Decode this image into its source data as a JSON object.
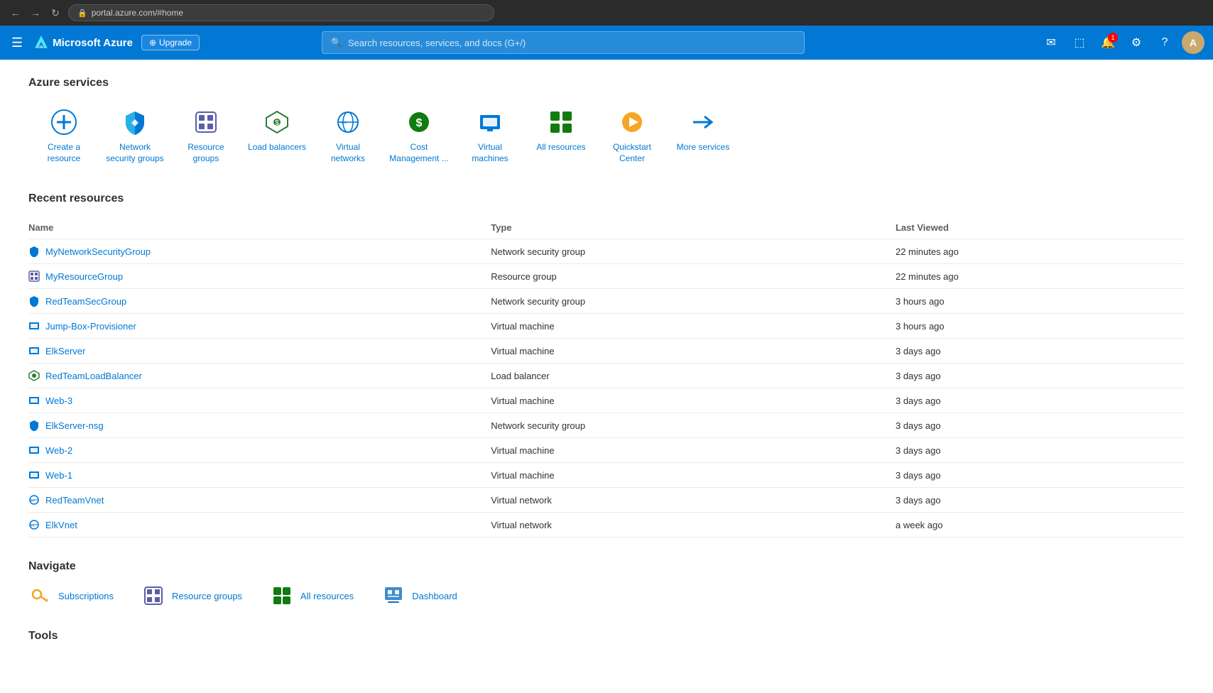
{
  "browser": {
    "url": "portal.azure.com/#home",
    "back_label": "←",
    "forward_label": "→",
    "refresh_label": "↻"
  },
  "nav": {
    "menu_icon": "☰",
    "brand": "Microsoft Azure",
    "upgrade_label": "⊕ Upgrade",
    "search_placeholder": "Search resources, services, and docs (G+/)",
    "icons": {
      "feedback": "✉",
      "cloud_shell": "⬚",
      "notifications_count": "1",
      "settings": "⚙",
      "help": "?",
      "avatar_initials": "A"
    }
  },
  "azure_services": {
    "section_title": "Azure services",
    "items": [
      {
        "id": "create-resource",
        "label": "Create a resource",
        "icon_type": "plus"
      },
      {
        "id": "nsg",
        "label": "Network security groups",
        "icon_type": "nsg"
      },
      {
        "id": "resource-groups",
        "label": "Resource groups",
        "icon_type": "rg"
      },
      {
        "id": "load-balancers",
        "label": "Load balancers",
        "icon_type": "lb"
      },
      {
        "id": "virtual-networks",
        "label": "Virtual networks",
        "icon_type": "vnet"
      },
      {
        "id": "cost-management",
        "label": "Cost Management ...",
        "icon_type": "cost"
      },
      {
        "id": "virtual-machines",
        "label": "Virtual machines",
        "icon_type": "vm"
      },
      {
        "id": "all-resources",
        "label": "All resources",
        "icon_type": "all"
      },
      {
        "id": "quickstart",
        "label": "Quickstart Center",
        "icon_type": "quickstart"
      },
      {
        "id": "more-services",
        "label": "More services",
        "icon_type": "arrow"
      }
    ]
  },
  "recent_resources": {
    "section_title": "Recent resources",
    "columns": {
      "name": "Name",
      "type": "Type",
      "last_viewed": "Last Viewed"
    },
    "rows": [
      {
        "name": "MyNetworkSecurityGroup",
        "type": "Network security group",
        "last_viewed": "22 minutes ago",
        "icon_type": "nsg"
      },
      {
        "name": "MyResourceGroup",
        "type": "Resource group",
        "last_viewed": "22 minutes ago",
        "icon_type": "rg"
      },
      {
        "name": "RedTeamSecGroup",
        "type": "Network security group",
        "last_viewed": "3 hours ago",
        "icon_type": "nsg"
      },
      {
        "name": "Jump-Box-Provisioner",
        "type": "Virtual machine",
        "last_viewed": "3 hours ago",
        "icon_type": "vm"
      },
      {
        "name": "ElkServer",
        "type": "Virtual machine",
        "last_viewed": "3 days ago",
        "icon_type": "vm"
      },
      {
        "name": "RedTeamLoadBalancer",
        "type": "Load balancer",
        "last_viewed": "3 days ago",
        "icon_type": "lb"
      },
      {
        "name": "Web-3",
        "type": "Virtual machine",
        "last_viewed": "3 days ago",
        "icon_type": "vm"
      },
      {
        "name": "ElkServer-nsg",
        "type": "Network security group",
        "last_viewed": "3 days ago",
        "icon_type": "nsg"
      },
      {
        "name": "Web-2",
        "type": "Virtual machine",
        "last_viewed": "3 days ago",
        "icon_type": "vm"
      },
      {
        "name": "Web-1",
        "type": "Virtual machine",
        "last_viewed": "3 days ago",
        "icon_type": "vm"
      },
      {
        "name": "RedTeamVnet",
        "type": "Virtual network",
        "last_viewed": "3 days ago",
        "icon_type": "vnet"
      },
      {
        "name": "ElkVnet",
        "type": "Virtual network",
        "last_viewed": "a week ago",
        "icon_type": "vnet"
      }
    ]
  },
  "navigate": {
    "section_title": "Navigate",
    "items": [
      {
        "id": "subscriptions",
        "label": "Subscriptions",
        "icon_type": "key"
      },
      {
        "id": "resource-groups",
        "label": "Resource groups",
        "icon_type": "rg"
      },
      {
        "id": "all-resources",
        "label": "All resources",
        "icon_type": "all"
      },
      {
        "id": "dashboard",
        "label": "Dashboard",
        "icon_type": "dashboard"
      }
    ]
  },
  "tools": {
    "section_title": "Tools"
  }
}
